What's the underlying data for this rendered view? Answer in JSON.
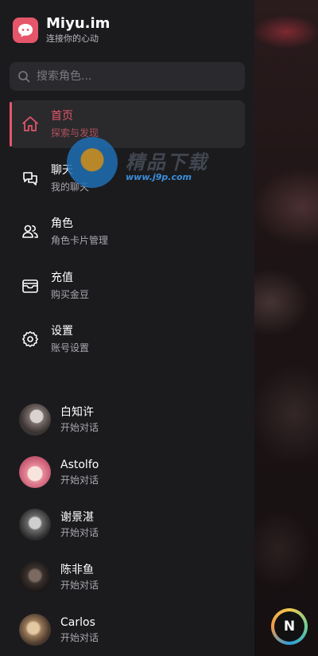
{
  "brand": {
    "title": "Miyu.im",
    "subtitle": "连接你的心动",
    "logo_color": "#e5566a"
  },
  "search": {
    "placeholder": "搜索角色..."
  },
  "nav": [
    {
      "label": "首页",
      "sub": "探索与发现",
      "icon": "home-icon",
      "active": true
    },
    {
      "label": "聊天",
      "sub": "我的聊天",
      "icon": "chat-icon"
    },
    {
      "label": "角色",
      "sub": "角色卡片管理",
      "icon": "users-icon"
    },
    {
      "label": "充值",
      "sub": "购买金豆",
      "icon": "wallet-icon"
    },
    {
      "label": "设置",
      "sub": "账号设置",
      "icon": "gear-icon"
    }
  ],
  "characters": [
    {
      "name": "白知许",
      "sub": "开始对话"
    },
    {
      "name": "Astolfo",
      "sub": "开始对话"
    },
    {
      "name": "谢景湛",
      "sub": "开始对话"
    },
    {
      "name": "陈非鱼",
      "sub": "开始对话"
    },
    {
      "name": "Carlos",
      "sub": "开始对话"
    }
  ],
  "watermark": {
    "text": "精品下载",
    "url": "www.j9p.com"
  },
  "badge": {
    "label": "N"
  },
  "colors": {
    "accent": "#e5566a",
    "sidebar_bg": "#1b1b1e",
    "search_bg": "#2a2a2e"
  }
}
